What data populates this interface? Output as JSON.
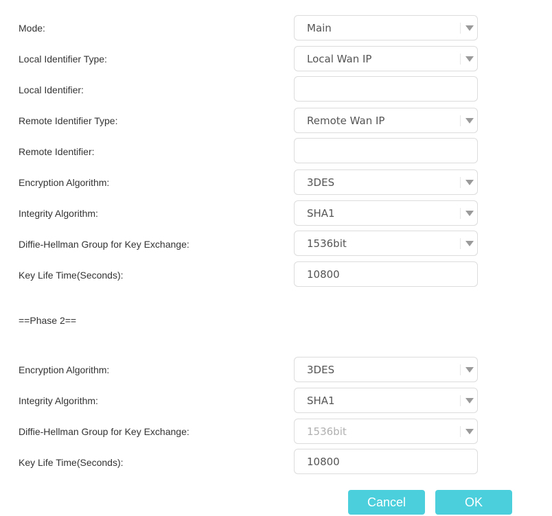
{
  "phase1": {
    "mode": {
      "label": "Mode:",
      "value": "Main"
    },
    "local_id_type": {
      "label": "Local Identifier Type:",
      "value": "Local Wan IP"
    },
    "local_id": {
      "label": "Local Identifier:",
      "value": ""
    },
    "remote_id_type": {
      "label": "Remote Identifier Type:",
      "value": "Remote Wan IP"
    },
    "remote_id": {
      "label": "Remote Identifier:",
      "value": ""
    },
    "encryption": {
      "label": "Encryption Algorithm:",
      "value": "3DES"
    },
    "integrity": {
      "label": "Integrity Algorithm:",
      "value": "SHA1"
    },
    "dh_group": {
      "label": "Diffie-Hellman Group for Key Exchange:",
      "value": "1536bit"
    },
    "key_life": {
      "label": "Key Life Time(Seconds):",
      "value": "10800"
    }
  },
  "phase2": {
    "heading": "==Phase 2==",
    "encryption": {
      "label": "Encryption Algorithm:",
      "value": "3DES"
    },
    "integrity": {
      "label": "Integrity Algorithm:",
      "value": "SHA1"
    },
    "dh_group": {
      "label": "Diffie-Hellman Group for Key Exchange:",
      "value": "1536bit"
    },
    "key_life": {
      "label": "Key Life Time(Seconds):",
      "value": "10800"
    }
  },
  "buttons": {
    "cancel": "Cancel",
    "ok": "OK"
  },
  "colors": {
    "button": "#4ccfdc",
    "border": "#dcdcdc",
    "disabled_text": "#b0b0b0"
  }
}
